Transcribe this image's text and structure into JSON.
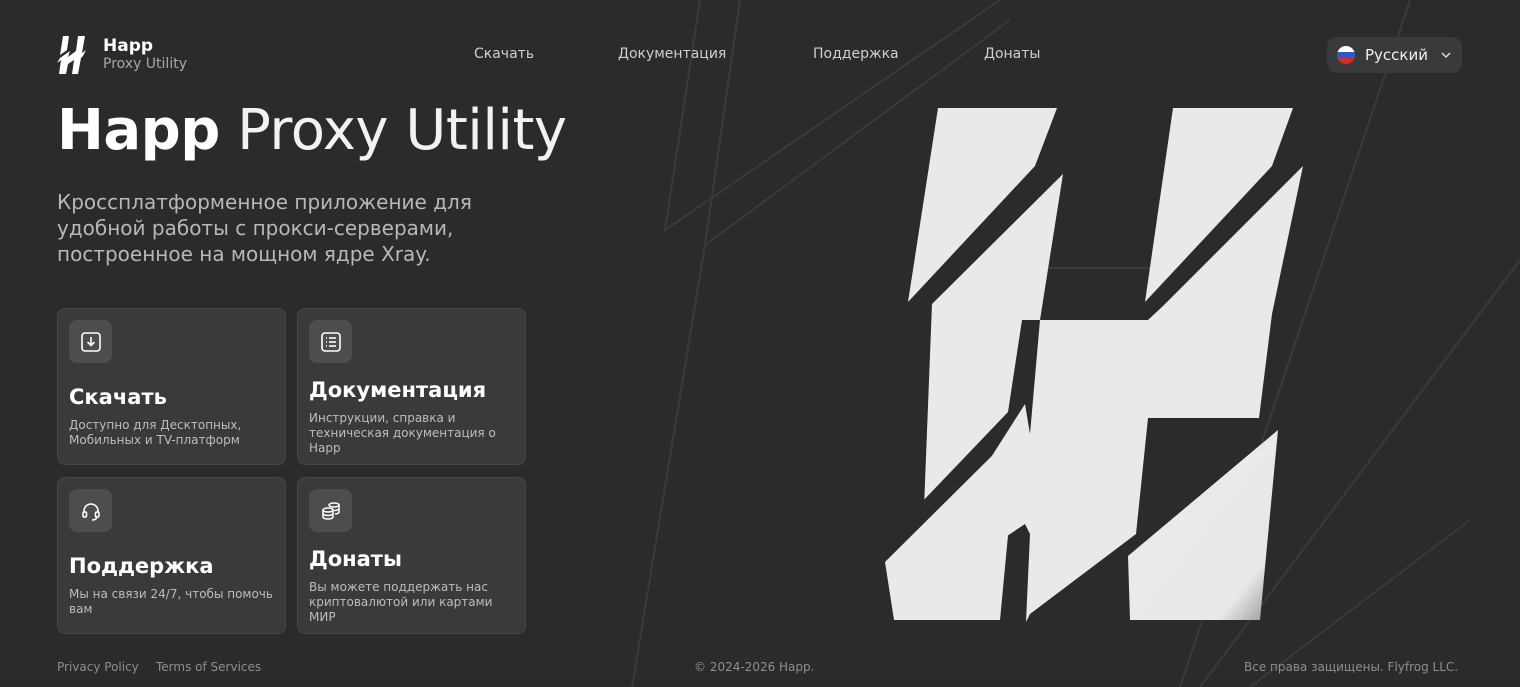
{
  "brand": {
    "name": "Happ",
    "subtitle": "Proxy Utility"
  },
  "nav": {
    "items": [
      {
        "label": "Скачать"
      },
      {
        "label": "Документация"
      },
      {
        "label": "Поддержка"
      },
      {
        "label": "Донаты"
      }
    ]
  },
  "language": {
    "selected": "Русский",
    "flag_icon": "russia-flag-icon"
  },
  "hero": {
    "title_bold": "Happ",
    "title_light": "Proxy Utility",
    "description": "Кроссплатформенное приложение для удобной работы с прокси-серверами, построенное на мощном ядре Xray."
  },
  "cards": [
    {
      "icon": "download-icon",
      "title": "Скачать",
      "description": "Доступно для Десктопных, Мобильных и TV-платформ"
    },
    {
      "icon": "documentation-icon",
      "title": "Документация",
      "description": "Инструкции, справка и техническая документация о Happ"
    },
    {
      "icon": "headset-icon",
      "title": "Поддержка",
      "description": "Мы на связи 24/7, чтобы помочь вам"
    },
    {
      "icon": "coins-icon",
      "title": "Донаты",
      "description": "Вы можете поддержать нас криптовалютой или картами МИР"
    }
  ],
  "footer": {
    "privacy": "Privacy Policy",
    "terms": "Terms of Services",
    "copyright": "© 2024-2026 Happ.",
    "rights": "Все права защищены. Flyfrog LLC."
  },
  "colors": {
    "background": "#2b2b2b",
    "card": "#3a3a3a",
    "text_primary": "#ffffff",
    "text_secondary": "#b8b8b8"
  }
}
